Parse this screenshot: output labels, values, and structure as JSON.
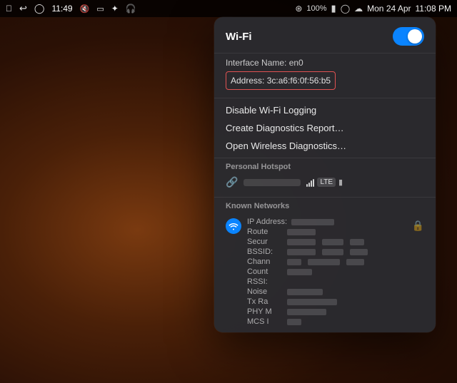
{
  "desktop": {
    "bg_description": "dark warm brown gradient desktop"
  },
  "menubar": {
    "left_icons": [
      "apple",
      "undo",
      "timer",
      "mute",
      "display",
      "bluetooth",
      "headphones"
    ],
    "time": "11:49",
    "right_items": [
      "wifi",
      "100%",
      "battery",
      "user",
      "cloud"
    ],
    "date": "Mon 24 Apr",
    "clock": "11:08 PM"
  },
  "wifi_panel": {
    "title": "Wi-Fi",
    "toggle_on": true,
    "interface_label": "Interface Name: en0",
    "address_label": "Address: 3c:a6:f6:0f:56:b5",
    "menu_items": [
      "Disable Wi-Fi Logging",
      "Create Diagnostics Report…",
      "Open Wireless Diagnostics…"
    ],
    "personal_hotspot": {
      "section_label": "Personal Hotspot",
      "signal_text": "LTE"
    },
    "known_networks": {
      "section_label": "Known Networks",
      "network": {
        "detail_rows": [
          {
            "label": "IP Address:",
            "value_width": 60
          },
          {
            "label": "Route",
            "value_width": 40
          },
          {
            "label": "Secur",
            "value_width": 90
          },
          {
            "label": "BSSID:",
            "value_width": 90
          },
          {
            "label": "Chann",
            "value_width": 70
          },
          {
            "label": "Count",
            "value_width": 50
          },
          {
            "label": "RSSI:",
            "value_width": 0
          },
          {
            "label": "Noise",
            "value_width": 50
          },
          {
            "label": "Tx Ra",
            "value_width": 70
          },
          {
            "label": "PHY M",
            "value_width": 55
          },
          {
            "label": "MCS I",
            "value_width": 20
          }
        ]
      }
    }
  }
}
